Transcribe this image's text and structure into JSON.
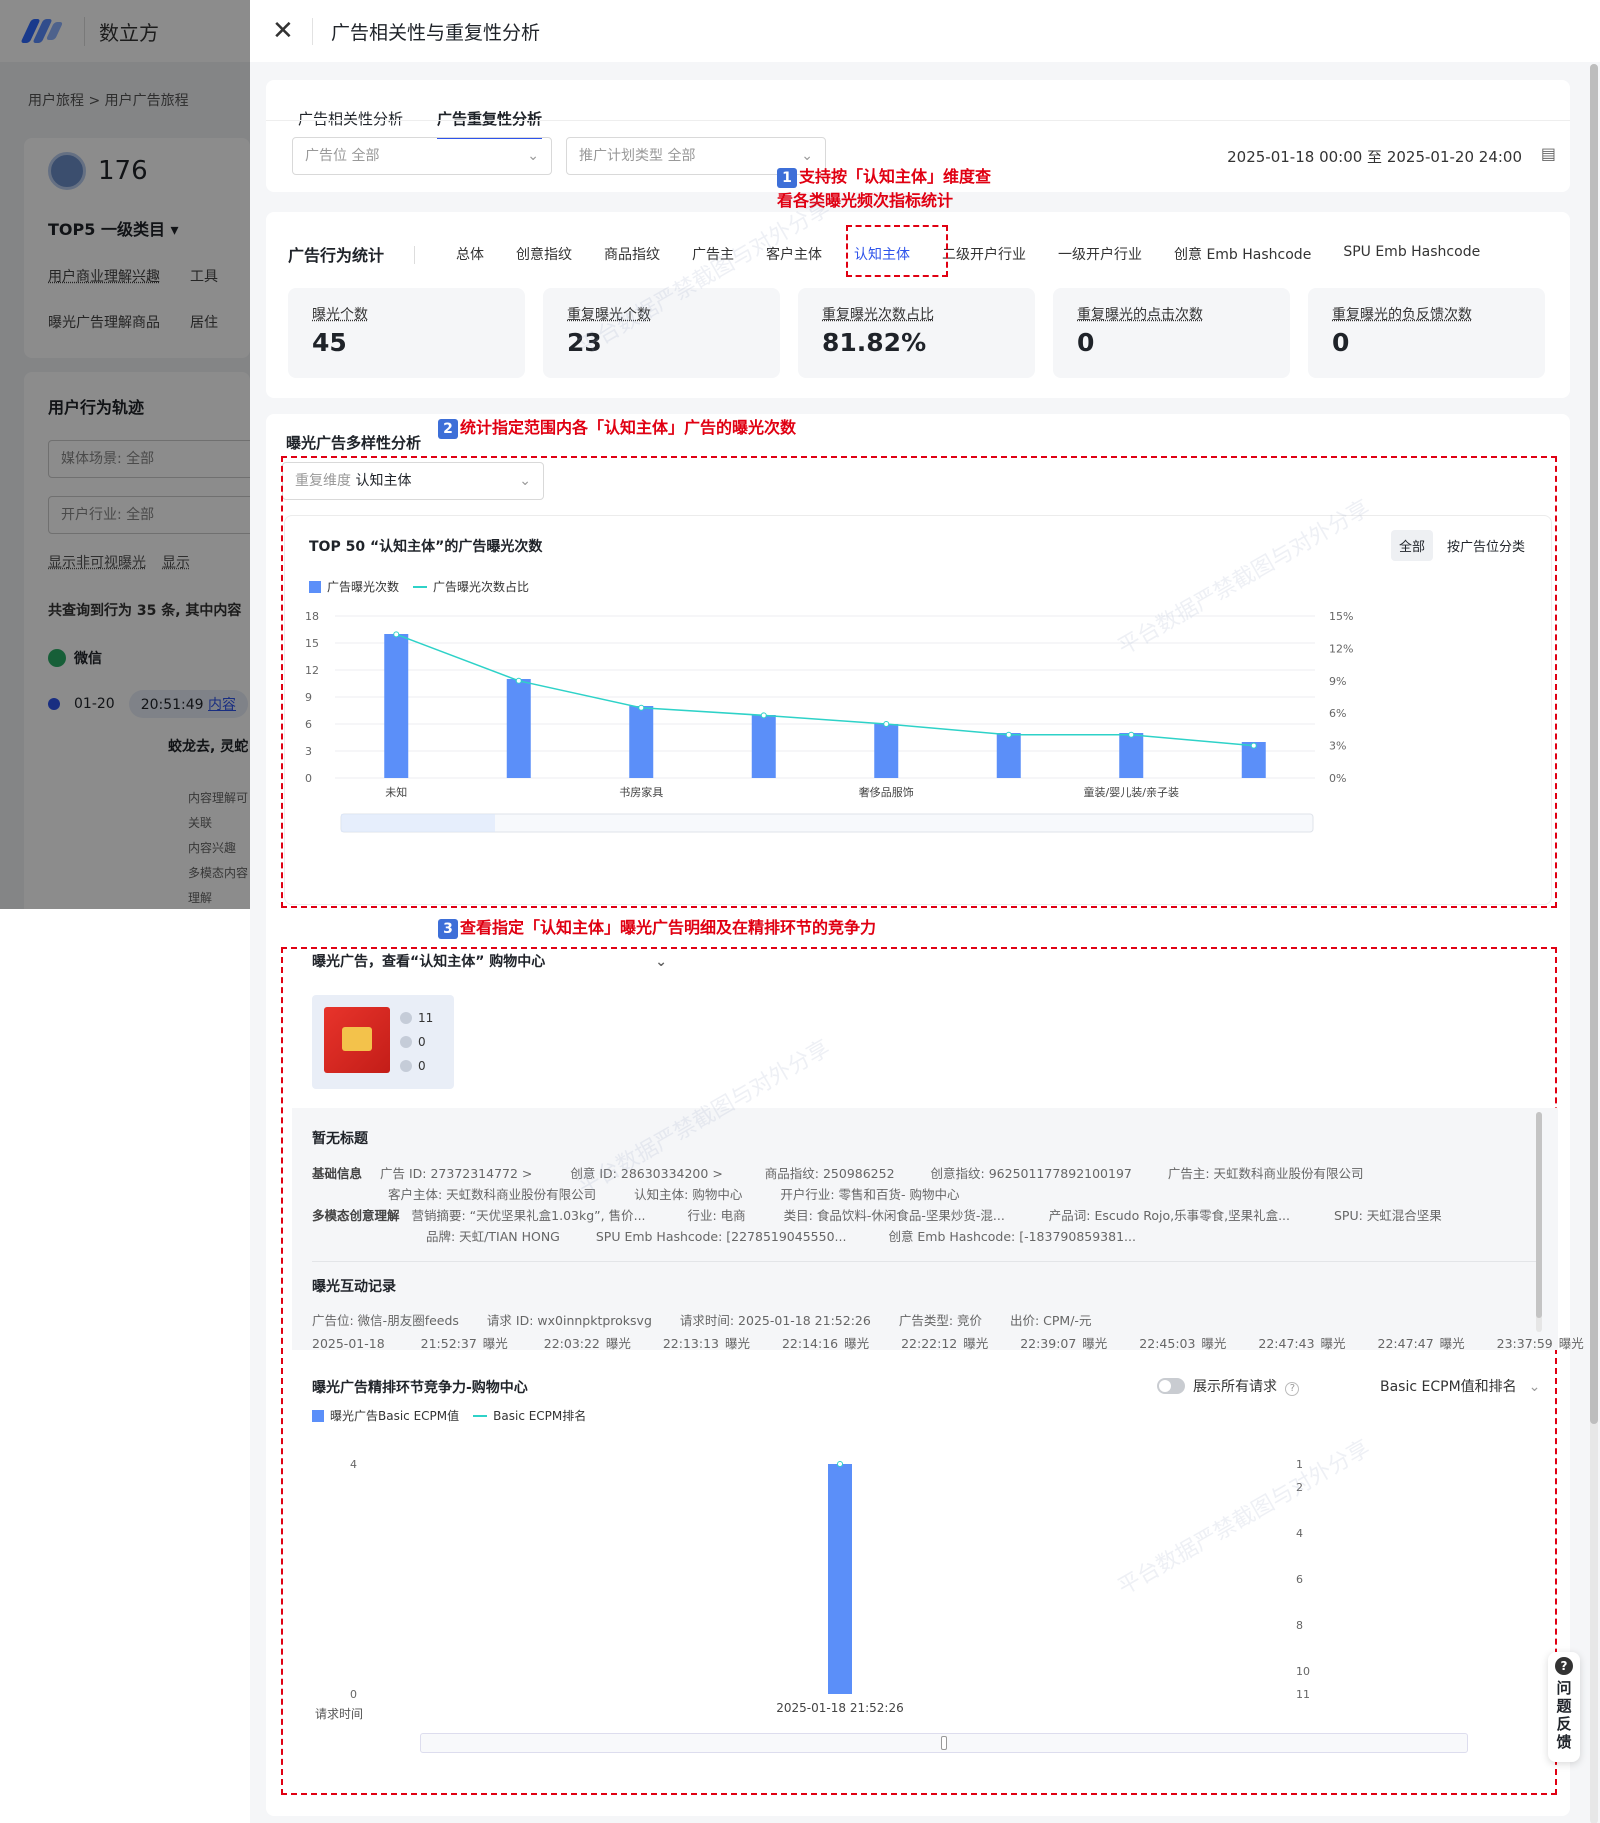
{
  "bg": {
    "brand": "数立方",
    "crumb": "用户旅程  >  用户广告旅程",
    "user_count": "176",
    "top5": "TOP5 一级类目 ▾",
    "row1_label": "用户商业理解兴趣",
    "row1_val": "工具",
    "row2_label": "曝光广告理解商品",
    "row2_val": "居住",
    "track_title": "用户行为轨迹",
    "media": "媒体场景: 全部",
    "industry": "开户行业: 全部",
    "check1": "显示非可视曝光",
    "check2": "显示",
    "count": "共查询到行为 35 条, 其中内容",
    "wechat": "微信",
    "date": "01-20",
    "time": "20:51:49",
    "time_link": "内容",
    "sub": "蛟龙去, 灵蛇",
    "meta1": "内容理解可关联",
    "meta2": "内容兴趣",
    "meta3": "多模态内容理解"
  },
  "drawer": {
    "title": "广告相关性与重复性分析",
    "tabs": [
      "广告相关性分析",
      "广告重复性分析"
    ],
    "filter_slot": {
      "key": "广告位",
      "val": "全部"
    },
    "filter_plan": {
      "key": "推广计划类型",
      "val": "全部"
    },
    "date_range": "2025-01-18 00:00 至 2025-01-20 24:00"
  },
  "annotations": {
    "a1_num": "1",
    "a1_l1": "支持按「认知主体」维度查",
    "a1_l2": "看各类曝光频次指标统计",
    "a2_num": "2",
    "a2": "统计指定范围内各「认知主体」广告的曝光次数",
    "a3_num": "3",
    "a3": "查看指定「认知主体」曝光广告明细及在精排环节的竞争力"
  },
  "stats": {
    "title": "广告行为统计",
    "dims": [
      "总体",
      "创意指纹",
      "商品指纹",
      "广告主",
      "客户主体",
      "认知主体",
      "二级开户行业",
      "一级开户行业",
      "创意 Emb Hashcode",
      "SPU Emb Hashcode"
    ],
    "cards": [
      {
        "label": "曝光个数",
        "value": "45"
      },
      {
        "label": "重复曝光个数",
        "value": "23"
      },
      {
        "label": "重复曝光次数占比",
        "value": "81.82%"
      },
      {
        "label": "重复曝光的点击次数",
        "value": "0"
      },
      {
        "label": "重复曝光的负反馈次数",
        "value": "0"
      }
    ]
  },
  "diversity": {
    "title": "曝光广告多样性分析",
    "dim_key": "重复维度",
    "dim_val": "认知主体",
    "chart_title": "TOP 50 “认知主体”的广告曝光次数",
    "toggle": [
      "全部",
      "按广告位分类"
    ],
    "legend": [
      "广告曝光次数",
      "广告曝光次数占比"
    ]
  },
  "detail": {
    "header": "曝光广告，查看“认知主体”  购物中心",
    "stats": [
      "11",
      "0",
      "0"
    ],
    "no_title": "暂无标题",
    "basic_label": "基础信息",
    "basic1": "广告 ID: 27372314772 >",
    "basic2": "创意 ID: 28630334200 >",
    "basic3": "商品指纹: 250986252",
    "basic4": "创意指纹: 962501177892100197",
    "basic5": "广告主: 天虹数科商业股份有限公司",
    "basic6": "客户主体: 天虹数科商业股份有限公司",
    "basic7": "认知主体: 购物中心",
    "basic8": "开户行业: 零售和百货- 购物中心",
    "mm_label": "多模态创意理解",
    "mm1": "营销摘要: “天优坚果礼盒1.03kg”, 售价...",
    "mm2": "行业: 电商",
    "mm3": "类目: 食品饮料-休闲食品-坚果炒货-混...",
    "mm4": "产品词: Escudo Rojo,乐事零食,坚果礼盒...",
    "mm5": "SPU: 天虹混合坚果",
    "mm6": "品牌: 天虹/TIAN HONG",
    "mm7": "SPU Emb Hashcode: [2278519045550...",
    "mm8": "创意 Emb Hashcode: [-183790859381...",
    "rec_title": "曝光互动记录",
    "rec_meta": [
      "广告位: 微信-朋友圈feeds",
      "请求 ID: wx0innpktproksvg",
      "请求时间: 2025-01-18 21:52:26",
      "广告类型: 竞价",
      "出价: CPM/-元"
    ],
    "rec_times": [
      "2025-01-18",
      "21:52:37 曝光",
      "22:03:22 曝光",
      "22:13:13 曝光",
      "22:14:16 曝光",
      "22:22:12 曝光",
      "22:39:07 曝光",
      "22:45:03 曝光",
      "22:47:43 曝光",
      "22:47:47 曝光",
      "23:37:59 曝光"
    ],
    "comp_title": "曝光广告精排环节竞争力-购物中心",
    "show_all": "展示所有请求",
    "metric_sel": "Basic ECPM值和排名",
    "legend": [
      "曝光广告Basic ECPM值",
      "Basic ECPM排名"
    ],
    "x_label": "请求时间"
  },
  "feedback": "问题反馈",
  "colors": {
    "accent": "#2f54eb",
    "bar": "#5b8ff9",
    "line": "#2ed2c8",
    "annotation": "#e00012"
  },
  "chart_data": [
    {
      "type": "bar",
      "title": "TOP 50 “认知主体”的广告曝光次数",
      "categories": [
        "未知",
        "",
        "书房家具",
        "",
        "奢侈品服饰",
        "",
        "童装/婴儿装/亲子装",
        ""
      ],
      "series": [
        {
          "name": "广告曝光次数",
          "type": "bar",
          "values": [
            16,
            11,
            8,
            7,
            6,
            5,
            5,
            4
          ]
        },
        {
          "name": "广告曝光次数占比",
          "type": "line",
          "values": [
            13.3,
            9.0,
            6.5,
            5.8,
            5.0,
            4.0,
            4.0,
            3.0
          ]
        }
      ],
      "ylim": [
        0,
        18
      ],
      "yticks": [
        0,
        3,
        6,
        9,
        12,
        15,
        18
      ],
      "y2lim": [
        0,
        15
      ],
      "y2ticks": [
        "0%",
        "3%",
        "6%",
        "9%",
        "12%",
        "15%"
      ],
      "legend": "top-left",
      "grid": true
    },
    {
      "type": "bar",
      "categories": [
        "2025-01-18 21:52:26"
      ],
      "series": [
        {
          "name": "曝光广告Basic ECPM值",
          "type": "bar",
          "values": [
            4
          ]
        },
        {
          "name": "Basic ECPM排名",
          "type": "line",
          "values": [
            1
          ]
        }
      ],
      "ylim": [
        0,
        4
      ],
      "yticks": [
        0,
        4
      ],
      "y2ticks": [
        1,
        2,
        4,
        6,
        8,
        10,
        11
      ],
      "xlabel": "请求时间",
      "legend": "top-left",
      "grid": false
    }
  ]
}
